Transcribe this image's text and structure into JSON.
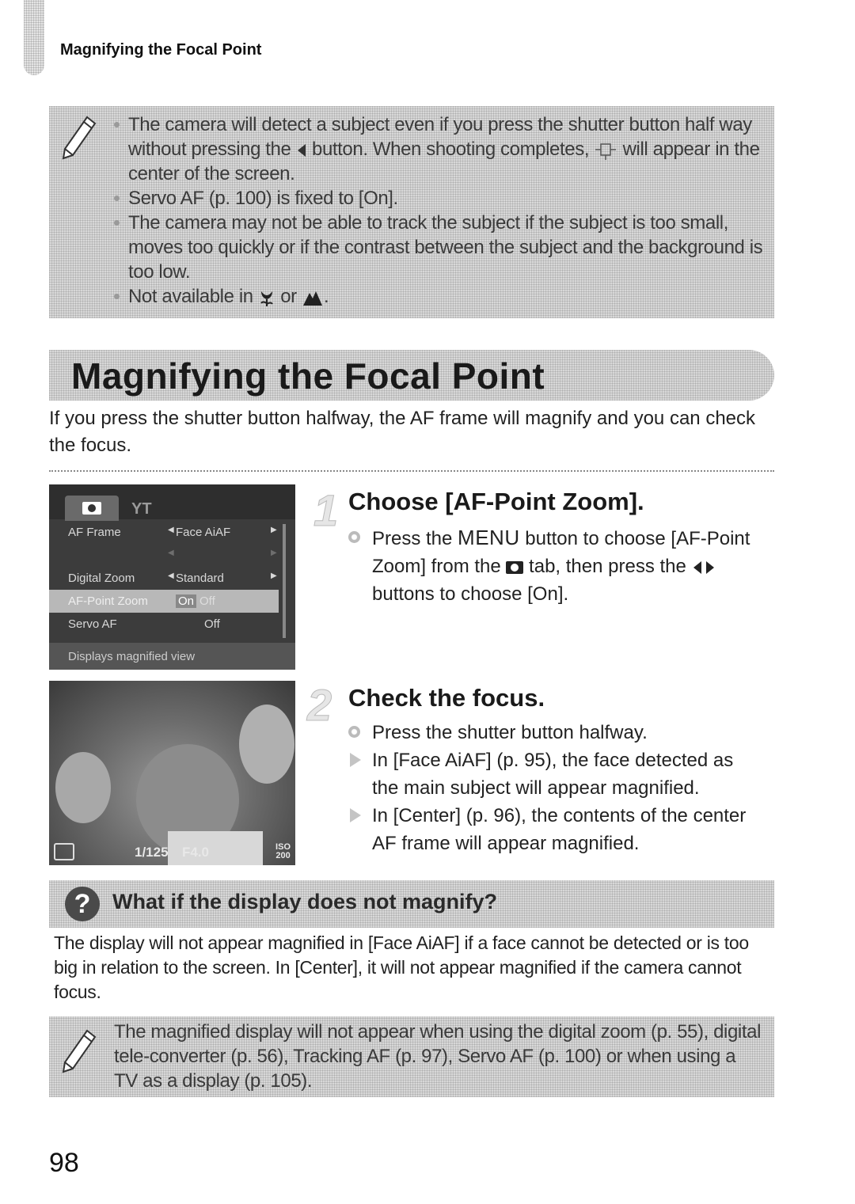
{
  "running_head": "Magnifying the Focal Point",
  "top_note": {
    "icon": "pencil-icon",
    "items": [
      {
        "parts": [
          "The camera will detect a subject even if you press the shutter button half way without pressing the ",
          " button. When shooting completes, ",
          " will appear in the center of the screen."
        ],
        "symbols": [
          "left-arrow-button-icon",
          "af-frame-icon"
        ]
      },
      {
        "text": "Servo AF (p. 100) is fixed to [On]."
      },
      {
        "text": "The camera may not be able to track the subject if the subject is too small, moves too quickly or if the contrast between the subject and the background is too low."
      },
      {
        "parts": [
          "Not available in ",
          " or ",
          "."
        ],
        "symbols": [
          "macro-tulip-icon",
          "infinity-mountain-icon"
        ]
      }
    ]
  },
  "section": {
    "title": "Magnifying the Focal Point",
    "intro": "If you press the shutter button halfway, the AF frame will magnify and you can check the focus."
  },
  "camera_menu": {
    "tabs": [
      "camera-tab-icon",
      "settings-tab-icon"
    ],
    "settings_tab_glyph": "YT",
    "rows": [
      {
        "label": "AF Frame",
        "value": "Face AiAF",
        "arrows": true
      },
      {
        "label": "",
        "value": "",
        "arrows": true,
        "faded": true
      },
      {
        "label": "Digital Zoom",
        "value": "Standard",
        "arrows": true
      },
      {
        "label": "AF-Point Zoom",
        "value_on": "On",
        "value_off": "Off",
        "selected": true
      },
      {
        "label": "Servo AF",
        "value": "Off"
      }
    ],
    "help_text": "Displays magnified view"
  },
  "photo_osd": {
    "shutter": "1/125",
    "aperture": "F4.0",
    "iso_label": "ISO",
    "iso_value": "200"
  },
  "steps": [
    {
      "number": "1",
      "title": "Choose [AF-Point Zoom].",
      "bullets": [
        {
          "type": "action",
          "parts": [
            "Press the ",
            "MENU",
            " button to choose [AF-Point Zoom] from the ",
            " tab, then press the ",
            " buttons to choose [On]."
          ],
          "symbols": [
            "camera-tab-icon",
            "left-right-arrows-icon"
          ]
        }
      ]
    },
    {
      "number": "2",
      "title": "Check the focus.",
      "bullets": [
        {
          "type": "action",
          "text": "Press the shutter button halfway."
        },
        {
          "type": "result",
          "text": "In [Face AiAF] (p. 95), the face detected as the main subject will appear magnified."
        },
        {
          "type": "result",
          "text": "In [Center] (p. 96), the contents of the center AF frame will appear magnified."
        }
      ]
    }
  ],
  "faq": {
    "icon": "question-icon",
    "icon_glyph": "?",
    "title": "What if the display does not magnify?",
    "body": "The display will not appear magnified in [Face AiAF] if a face cannot be detected or is too big in relation to the screen. In [Center], it will not appear magnified if the camera cannot focus."
  },
  "bottom_note": {
    "icon": "pencil-icon",
    "text": "The magnified display will not appear when using the digital zoom (p. 55), digital tele-converter (p. 56), Tracking AF (p. 97), Servo AF (p. 100) or when using a TV as a display (p. 105)."
  },
  "page_number": "98"
}
